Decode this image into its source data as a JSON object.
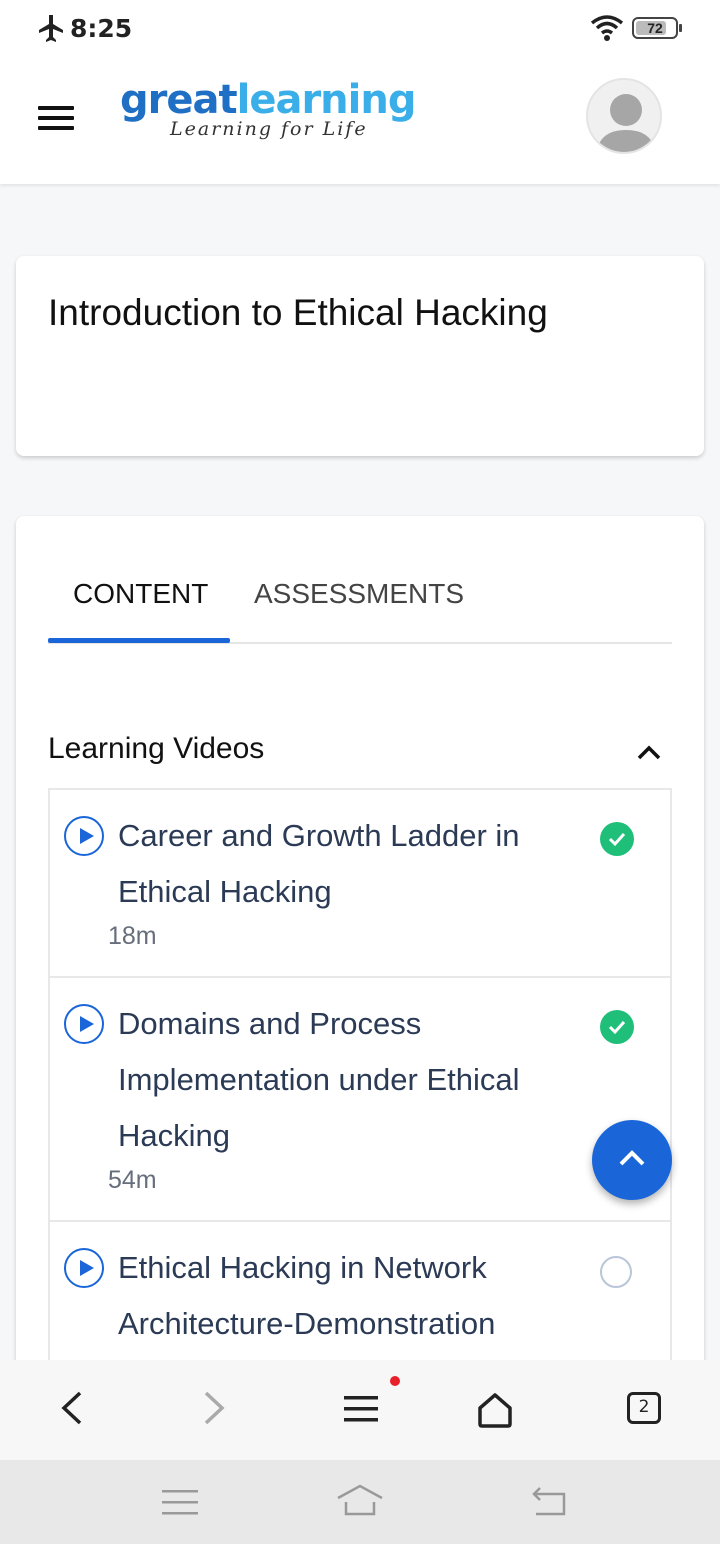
{
  "status_bar": {
    "time": "8:25",
    "battery": "72",
    "icons": [
      "airplane-icon",
      "wifi-icon",
      "battery-icon"
    ]
  },
  "header": {
    "logo_part1": "great",
    "logo_part2": "learning",
    "tagline": "Learning for Life",
    "colors": {
      "logo_dark": "#1f6fc5",
      "logo_light": "#3aaee8"
    }
  },
  "course": {
    "title": "Introduction to Ethical Hacking"
  },
  "tabs": [
    {
      "label": "CONTENT",
      "active": true
    },
    {
      "label": "ASSESSMENTS",
      "active": false
    }
  ],
  "section": {
    "title": "Learning Videos",
    "expanded": true
  },
  "videos": [
    {
      "title": "Career and Growth Ladder in Ethical Hacking",
      "duration": "18m",
      "completed": true
    },
    {
      "title": "Domains and Process Implementation under Ethical Hacking",
      "duration": "54m",
      "completed": true
    },
    {
      "title": "Ethical Hacking in Network Architecture-Demonstration",
      "duration": "",
      "completed": false
    }
  ],
  "browser_bar": {
    "tab_count": "2",
    "has_notification": true,
    "icons": [
      "back-icon",
      "forward-icon",
      "menu-icon",
      "home-icon",
      "tabs-icon"
    ]
  },
  "system_nav": {
    "icons": [
      "recents-icon",
      "home-icon",
      "back-icon"
    ]
  },
  "accent_color": "#1a66d9",
  "success_color": "#1fbf7a"
}
